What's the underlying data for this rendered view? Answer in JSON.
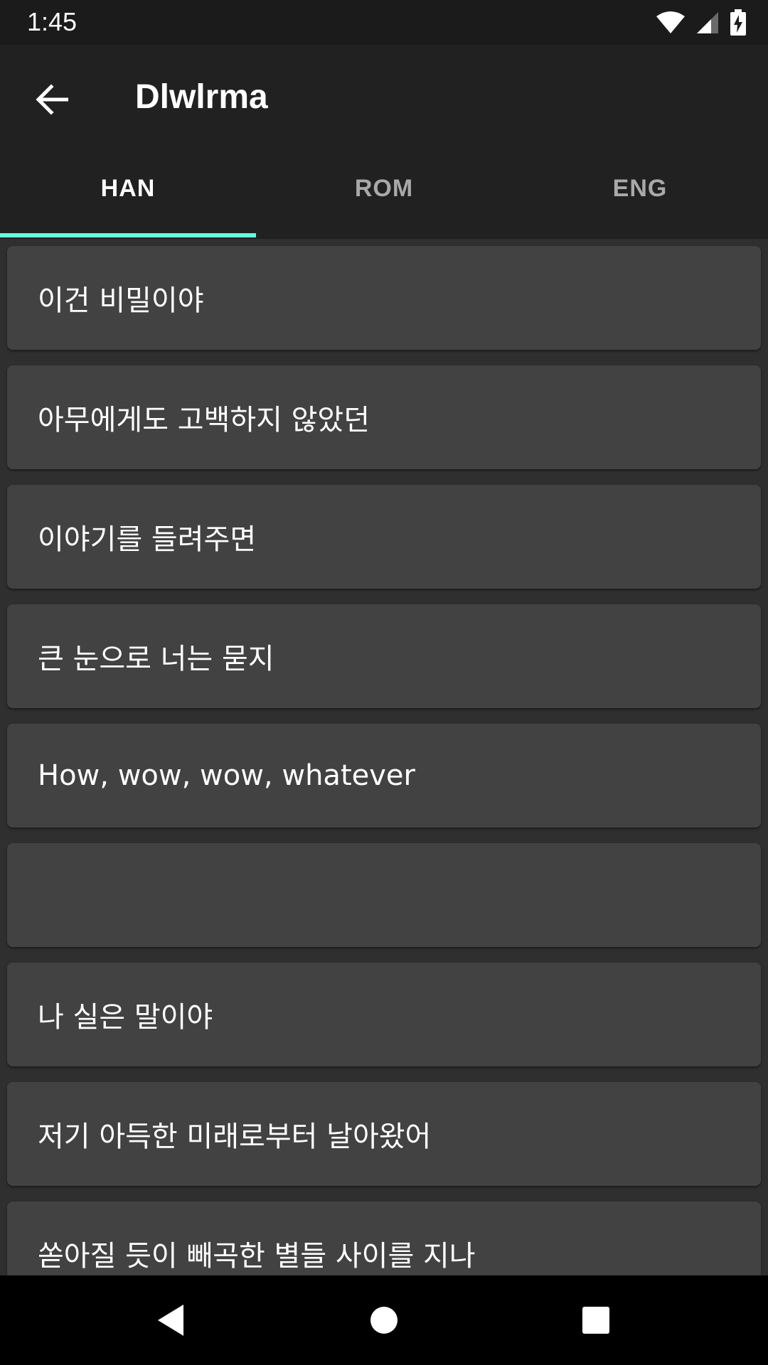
{
  "status_bar": {
    "time": "1:45",
    "icons": [
      "wifi-icon",
      "signal-icon",
      "battery-charging-icon"
    ]
  },
  "app_bar": {
    "title": "Dlwlrma",
    "back_icon": "arrow-back-icon"
  },
  "tabs": [
    {
      "label": "HAN",
      "active": true
    },
    {
      "label": "ROM",
      "active": false
    },
    {
      "label": "ENG",
      "active": false
    }
  ],
  "lyrics": [
    "이건 비밀이야",
    "아무에게도 고백하지 않았던",
    "이야기를 들려주면",
    "큰 눈으로 너는 묻지",
    "How, wow, wow, whatever",
    "",
    "나 실은 말이야",
    "저기 아득한 미래로부터 날아왔어",
    "쏟아질 듯이 빼곡한 별들 사이를 지나"
  ],
  "nav_bar": {
    "icons": [
      "back-triangle-icon",
      "home-circle-icon",
      "recents-square-icon"
    ]
  },
  "colors": {
    "accent": "#64ffda",
    "app_bar": "#212121",
    "card": "#424242",
    "background": "#2f2f2f"
  }
}
